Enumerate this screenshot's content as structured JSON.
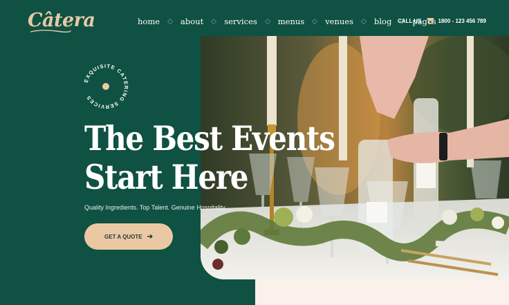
{
  "brand": {
    "name": "Câtera",
    "accent": "#e8c9a6",
    "background": "#0f5142"
  },
  "nav": {
    "items": [
      {
        "label": "home"
      },
      {
        "label": "about"
      },
      {
        "label": "services"
      },
      {
        "label": "menus"
      },
      {
        "label": "venues"
      },
      {
        "label": "blog"
      },
      {
        "label": "pages"
      }
    ]
  },
  "contact": {
    "label": "CALL US",
    "phone": "1800 - 123 456 789",
    "icon": "phone-icon"
  },
  "badge": {
    "text": "EXQUISITE CATERING SERVICES"
  },
  "hero": {
    "title_line1": "The Best Events",
    "title_line2": "Start Here",
    "subtitle": "Quality Ingredients. Top Talent. Genuine Hospitality.",
    "cta_label": "GET A QUOTE",
    "cta_icon": "arrow-right-icon",
    "cta_color": "#ebc8a4"
  }
}
